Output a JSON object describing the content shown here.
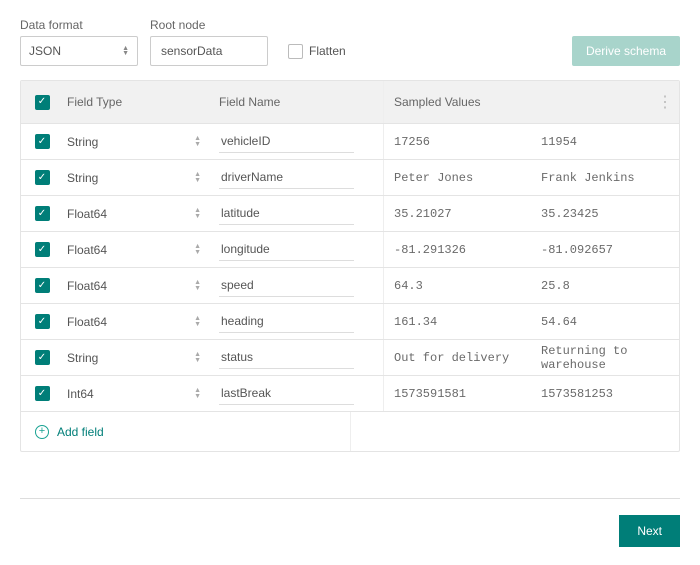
{
  "controls": {
    "dataFormatLabel": "Data format",
    "dataFormatValue": "JSON",
    "rootNodeLabel": "Root node",
    "rootNodeValue": "sensorData",
    "flattenLabel": "Flatten",
    "deriveLabel": "Derive schema"
  },
  "columns": {
    "type": "Field Type",
    "name": "Field Name",
    "samples": "Sampled Values"
  },
  "rows": [
    {
      "type": "String",
      "name": "vehicleID",
      "s1": "17256",
      "s2": "11954"
    },
    {
      "type": "String",
      "name": "driverName",
      "s1": "Peter Jones",
      "s2": "Frank Jenkins"
    },
    {
      "type": "Float64",
      "name": "latitude",
      "s1": "35.21027",
      "s2": "35.23425"
    },
    {
      "type": "Float64",
      "name": "longitude",
      "s1": "-81.291326",
      "s2": "-81.092657"
    },
    {
      "type": "Float64",
      "name": "speed",
      "s1": "64.3",
      "s2": "25.8"
    },
    {
      "type": "Float64",
      "name": "heading",
      "s1": "161.34",
      "s2": "54.64"
    },
    {
      "type": "String",
      "name": "status",
      "s1": "Out for delivery",
      "s2": "Returning to warehouse"
    },
    {
      "type": "Int64",
      "name": "lastBreak",
      "s1": "1573591581",
      "s2": "1573581253"
    }
  ],
  "addField": "Add field",
  "next": "Next"
}
